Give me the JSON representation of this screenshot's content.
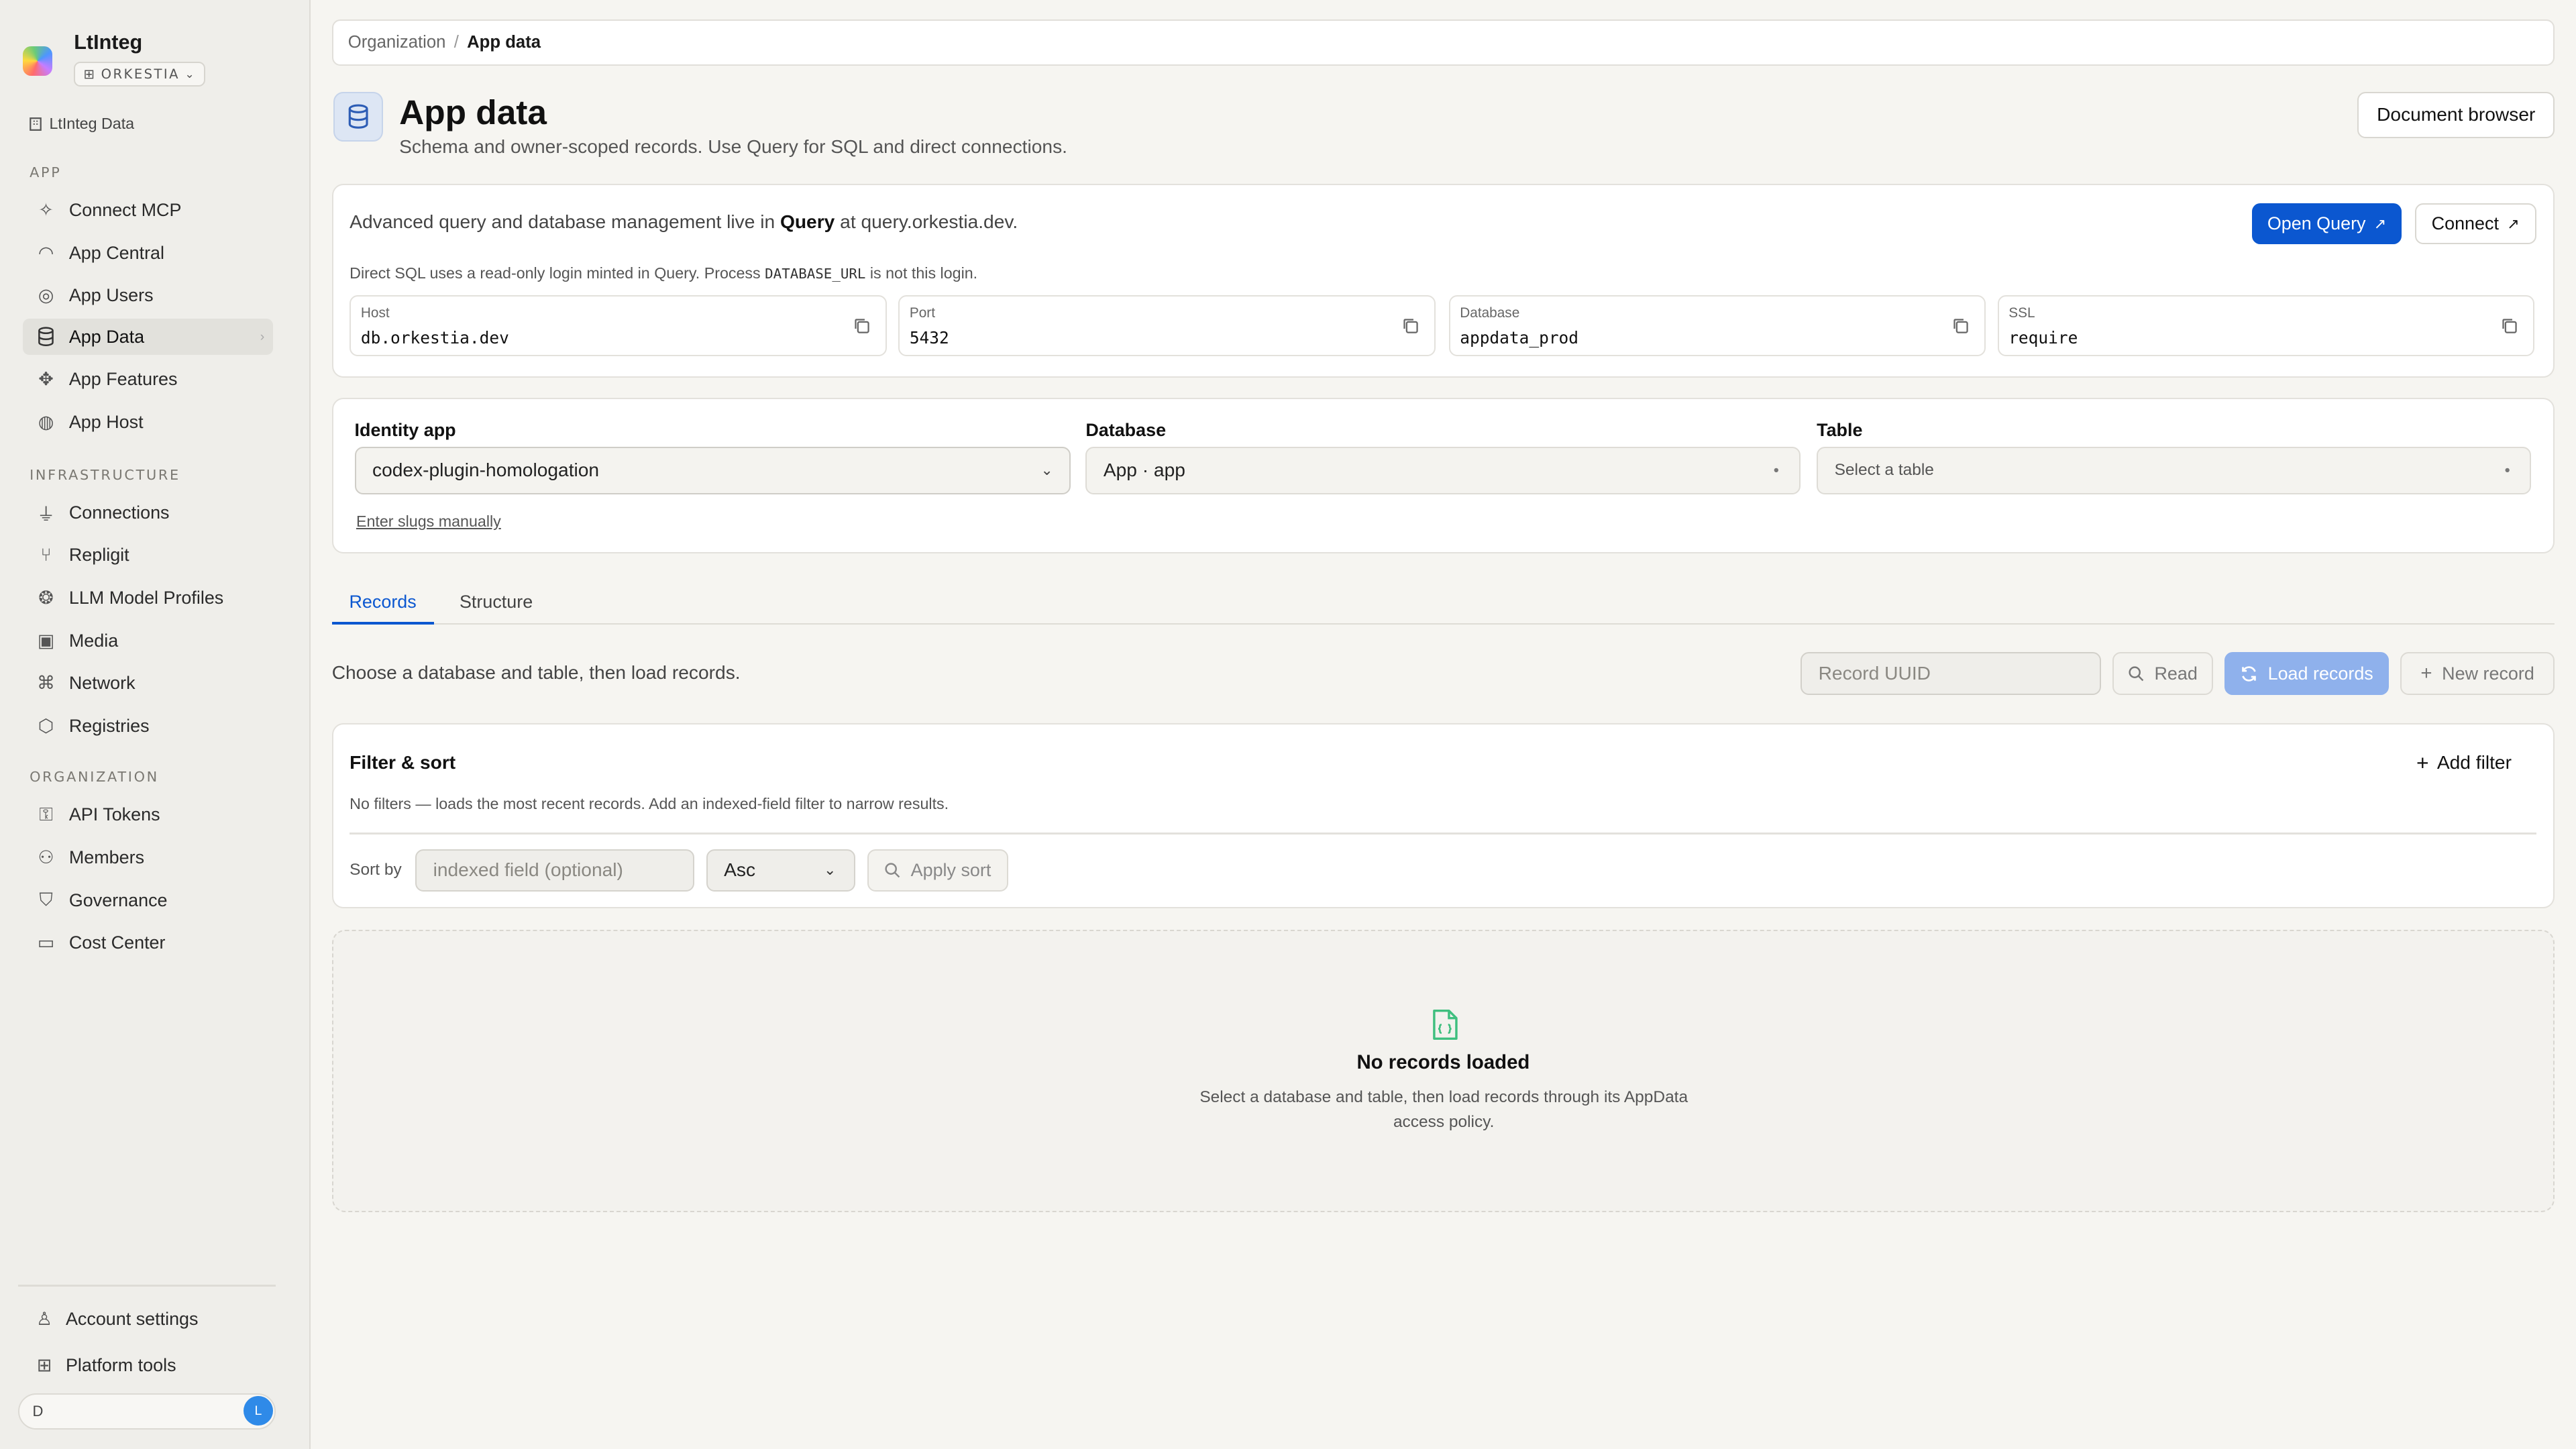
{
  "sidebar": {
    "brand": "LtInteg",
    "org": "ORKESTIA",
    "scope": "LtInteg Data",
    "sections": {
      "app": "APP",
      "infrastructure": "INFRASTRUCTURE",
      "organization": "ORGANIZATION"
    },
    "app_items": [
      "Connect MCP",
      "App Central",
      "App Users",
      "App Data",
      "App Features",
      "App Host"
    ],
    "infra_items": [
      "Connections",
      "Repligit",
      "LLM Model Profiles",
      "Media",
      "Network",
      "Registries"
    ],
    "org_items": [
      "API Tokens",
      "Members",
      "Governance",
      "Cost Center"
    ],
    "footer": {
      "account": "Account settings",
      "platform": "Platform tools",
      "user_initial": "D",
      "avatar_letter": "L"
    }
  },
  "breadcrumb": {
    "parent": "Organization",
    "separator": "/",
    "current": "App data"
  },
  "header": {
    "title": "App data",
    "subtitle": "Schema and owner-scoped records. Use Query for SQL and direct connections.",
    "document_browser": "Document browser"
  },
  "connection": {
    "lead_prefix": "Advanced query and database management live in",
    "lead_bold": "Query",
    "lead_suffix": "at query.orkestia.dev.",
    "open_query": "Open Query",
    "connect": "Connect",
    "note_prefix": "Direct SQL uses a read-only login minted in Query. Process",
    "note_code": "DATABASE_URL",
    "note_suffix": "is not this login.",
    "fields": [
      {
        "label": "Host",
        "value": "db.orkestia.dev"
      },
      {
        "label": "Port",
        "value": "5432"
      },
      {
        "label": "Database",
        "value": "appdata_prod"
      },
      {
        "label": "SSL",
        "value": "require"
      }
    ]
  },
  "scope": {
    "identity_label": "Identity app",
    "identity_value": "codex-plugin-homologation",
    "database_label": "Database",
    "database_value": "App · app",
    "table_label": "Table",
    "table_placeholder": "Select a table",
    "manual_link": "Enter slugs manually"
  },
  "tabs": [
    "Records",
    "Structure"
  ],
  "records": {
    "hint": "Choose a database and table, then load records.",
    "uuid_placeholder": "Record UUID",
    "read": "Read",
    "load": "Load records",
    "new": "New record"
  },
  "filter": {
    "title": "Filter & sort",
    "add": "Add filter",
    "note": "No filters — loads the most recent records. Add an indexed-field filter to narrow results.",
    "sort_label": "Sort by",
    "sort_placeholder": "indexed field (optional)",
    "sort_order": "Asc",
    "apply": "Apply sort"
  },
  "empty": {
    "title": "No records loaded",
    "description": "Select a database and table, then load records through its AppData access policy."
  },
  "colors": {
    "accent": "#0b57d0",
    "accent_soft": "#8fb1ec",
    "empty_icon": "#3fbf7f"
  }
}
